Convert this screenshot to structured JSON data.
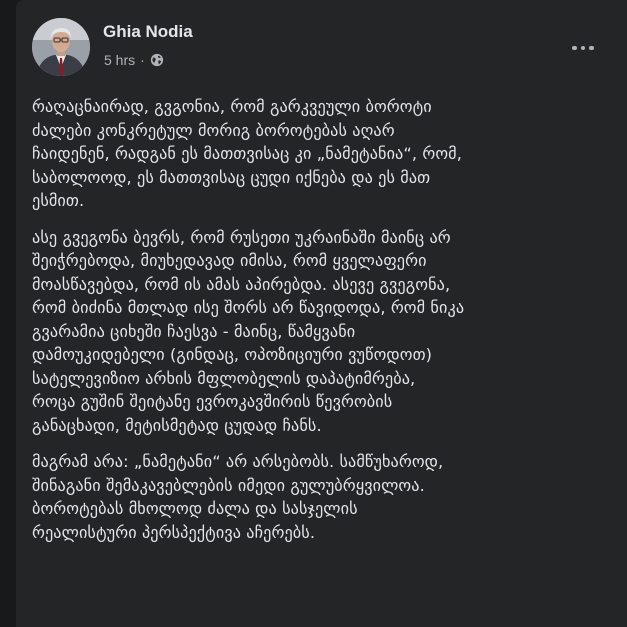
{
  "post": {
    "author": "Ghia Nodia",
    "time": "5 hrs",
    "separator": "·",
    "privacy_icon": "globe-icon",
    "more_icon": "more-options-icon",
    "paragraphs": [
      "რაღაცნაირად, გვგონია, რომ გარკვეული ბოროტი\nძალები კონკრეტულ მორიგ ბოროტებას აღარ\nჩაიდენენ, რადგან ეს მათთვისაც კი „ნამეტანია“, რომ,\nსაბოლოოდ, ეს მათთვისაც ცუდი იქნება და ეს მათ\nესმით.",
      "ასე გვეგონა ბევრს, რომ რუსეთი უკრაინაში მაინც არ\nშეიჭრებოდა, მიუხედავად იმისა, რომ ყველაფერი\nმოასწავებდა, რომ ის ამას აპირებდა. ასევე გვეგონა,\nრომ ბიძინა მთლად ისე შორს არ წავიდოდა, რომ ნიკა\nგვარამია ციხეში ჩაესვა - მაინც, წამყვანი\nდამოუკიდებელი (გინდაც, ოპოზიციური ვუწოდოთ)\nსატელევიზიო არხის მფლობელის დაპატიმრება,\nროცა გუშინ შეიტანე ევროკავშირის წევრობის\nგანაცხადი, მეტისმეტად ცუდად ჩანს.",
      "მაგრამ არა: „ნამეტანი“ არ არსებობს. სამწუხაროდ,\nშინაგანი შემაკავებლების იმედი გულუბრყვილოა.\nბოროტებას მხოლოდ ძალა და სასჯელის\nრეალისტური პერსპექტივა აჩერებს."
    ]
  },
  "colors": {
    "page_bg": "#18191a",
    "card_bg": "#242526",
    "primary_text": "#e4e6eb",
    "secondary_text": "#b0b3b8"
  }
}
